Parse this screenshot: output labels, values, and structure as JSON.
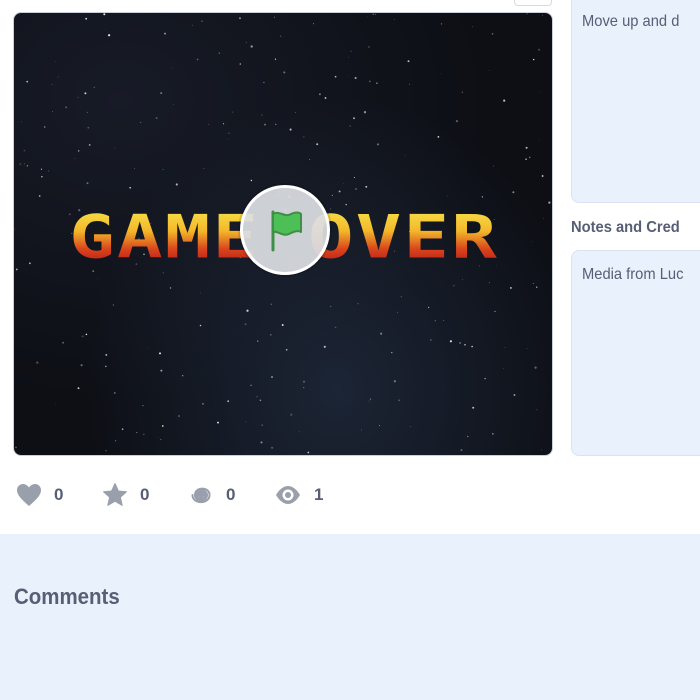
{
  "project": {
    "stage_title": "GAME OVER",
    "instructions_text": "Move up and d",
    "notes_heading": "Notes and Cred",
    "notes_text": "Media from Luc"
  },
  "stats": {
    "loves": "0",
    "favorites": "0",
    "remixes": "0",
    "views": "1"
  },
  "comments": {
    "title": "Comments"
  },
  "icons": {
    "play": "green-flag-icon",
    "love": "heart-icon",
    "favorite": "star-icon",
    "remix": "spiral-icon",
    "views": "eye-icon"
  },
  "colors": {
    "panel_bg": "#e9f1fc",
    "text": "#575e75",
    "flag_green": "#4cbf56",
    "stat_icon": "#9a9fac"
  }
}
